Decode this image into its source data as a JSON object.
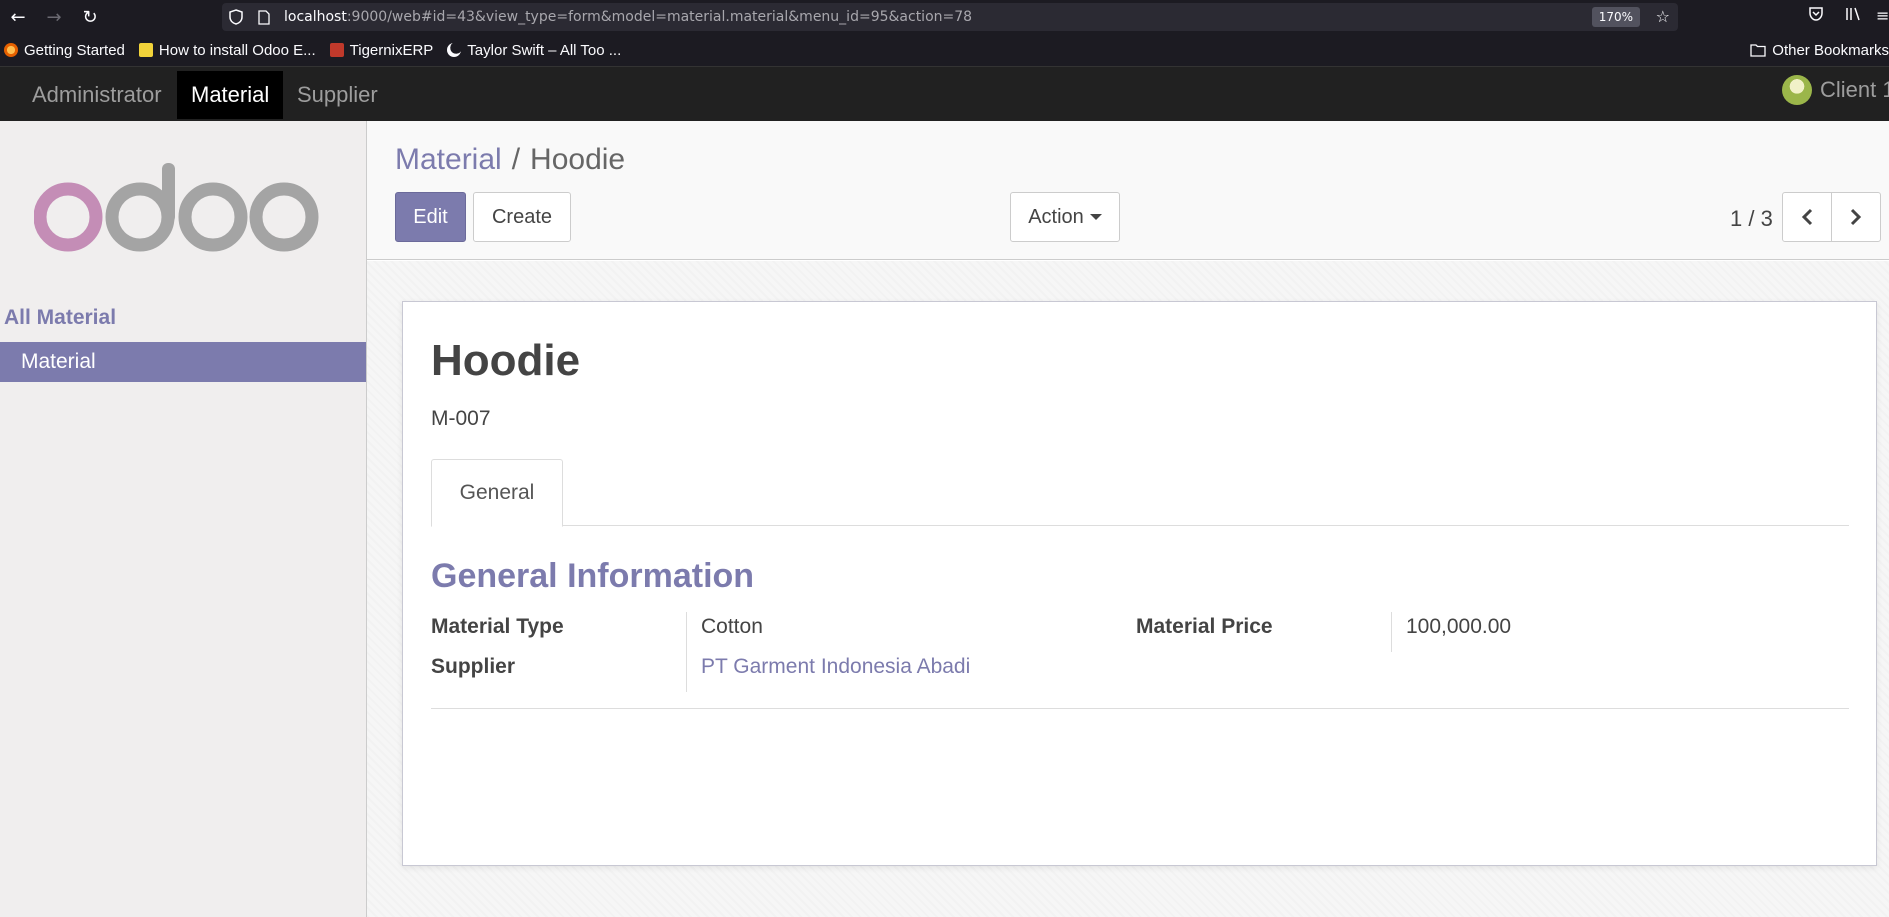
{
  "browser": {
    "url_host": "localhost",
    "url_path": ":9000/web#id=43&view_type=form&model=material.material&menu_id=95&action=78",
    "zoom": "170%",
    "bookmarks": [
      "Getting Started",
      "How to install Odoo E...",
      "TigernixERP",
      "Taylor Swift – All Too ..."
    ],
    "other_bookmarks": "Other Bookmarks"
  },
  "navbar": {
    "menus": [
      "Administrator",
      "Material",
      "Supplier"
    ],
    "user": "Client 1"
  },
  "sidebar": {
    "heading": "All Material",
    "items": [
      {
        "label": "Material"
      }
    ]
  },
  "control_panel": {
    "breadcrumb_parent": "Material",
    "breadcrumb_sep": "/",
    "breadcrumb_current": "Hoodie",
    "edit_label": "Edit",
    "create_label": "Create",
    "action_label": "Action",
    "pager": "1 / 3"
  },
  "form": {
    "title": "Hoodie",
    "code": "M-007",
    "tab": "General",
    "group_title": "General Information",
    "fields": {
      "material_type_label": "Material Type",
      "material_type_value": "Cotton",
      "supplier_label": "Supplier",
      "supplier_value": "PT Garment Indonesia Abadi",
      "material_price_label": "Material Price",
      "material_price_value": "100,000.00"
    }
  },
  "colors": {
    "accent": "#7c7bad",
    "navbar": "#212121",
    "browser_chrome": "#1c1b22"
  }
}
